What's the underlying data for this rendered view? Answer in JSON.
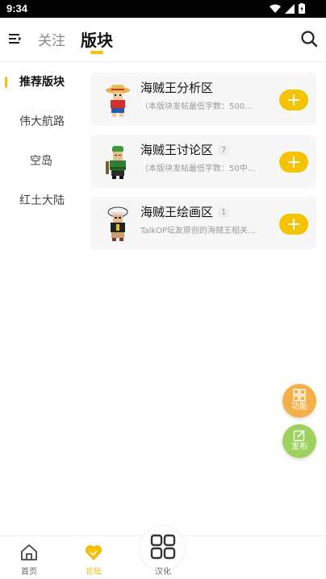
{
  "status_bar": {
    "time": "9:34"
  },
  "header": {
    "tabs": [
      {
        "label": "关注"
      },
      {
        "label": "版块"
      }
    ],
    "accent_color": "#f5c300"
  },
  "sidebar": {
    "items": [
      {
        "label": "推荐版块"
      },
      {
        "label": "伟大航路"
      },
      {
        "label": "空岛"
      },
      {
        "label": "红土大陆"
      }
    ]
  },
  "boards": [
    {
      "title": "海贼王分析区",
      "count": "",
      "desc": "（本版块发帖最低字数：500..."
    },
    {
      "title": "海贼王讨论区",
      "count": "7",
      "desc": "（本版块发帖最低字数：50中..."
    },
    {
      "title": "海贼王绘画区",
      "count": "1",
      "desc": "TalkOP坛友原创的海贼王相关..."
    }
  ],
  "fabs": {
    "func_label": "功能",
    "post_label": "发布"
  },
  "bottom_nav": {
    "items": [
      {
        "label": "首页",
        "icon": "home-icon"
      },
      {
        "label": "论坛",
        "icon": "heart-icon"
      },
      {
        "label": "汉化",
        "icon": "grid-icon"
      }
    ]
  }
}
